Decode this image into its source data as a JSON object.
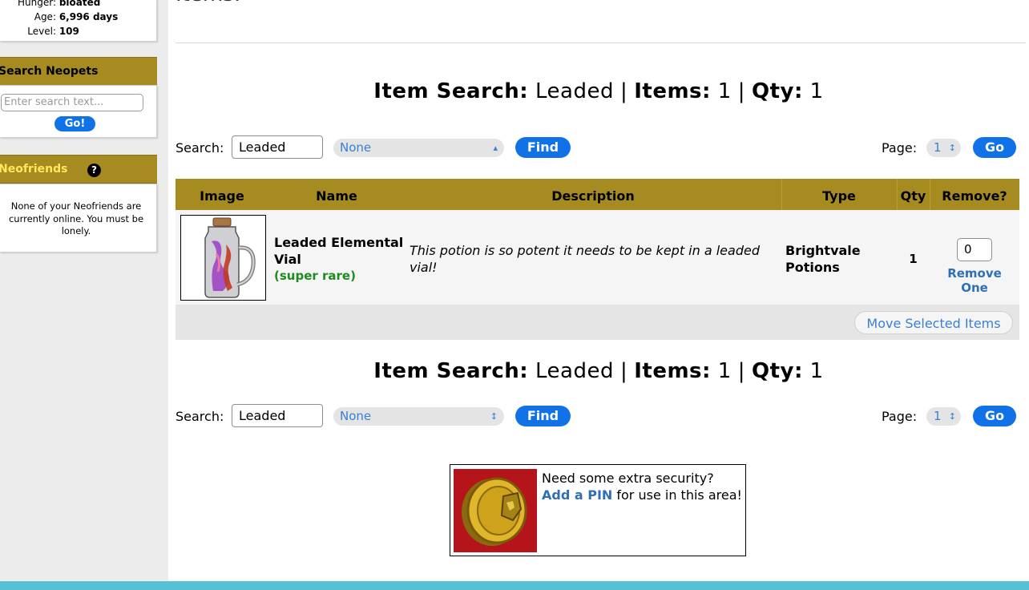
{
  "pet_stats": [
    {
      "label": "Hunger:",
      "value": "bloated"
    },
    {
      "label": "Age:",
      "value": "6,996 days"
    },
    {
      "label": "Level:",
      "value": "109"
    }
  ],
  "search_neopets": {
    "title": "Search Neopets",
    "placeholder": "Enter search text...",
    "go_label": "Go!"
  },
  "neofriends": {
    "title": "Neofriends",
    "help_icon": "?",
    "message": "None of your Neofriends are currently online. You must be lonely."
  },
  "heading": "Items:",
  "summary": {
    "item_search_label": "Item Search:",
    "item_search_value": "Leaded",
    "items_label": "Items:",
    "items_value": "1",
    "qty_label": "Qty:",
    "qty_value": "1",
    "separator": "|"
  },
  "search_bar": {
    "search_label": "Search:",
    "search_value": "Leaded",
    "filter_value": "None",
    "find_label": "Find",
    "page_label": "Page:",
    "page_value": "1",
    "go_label": "Go"
  },
  "table": {
    "headers": [
      "Image",
      "Name",
      "Description",
      "Type",
      "Qty",
      "Remove?"
    ],
    "rows": [
      {
        "name": "Leaded Elemental Vial",
        "rarity": "(super rare)",
        "description": "This potion is so potent it needs to be kept in a leaded vial!",
        "type": "Brightvale Potions",
        "qty": "1",
        "remove_value": "0",
        "remove_one_label": "Remove One"
      }
    ],
    "move_selected_label": "Move Selected Items"
  },
  "pin_promo": {
    "line1": "Need some extra security?",
    "link_text": "Add a PIN",
    "line2_rest": " for use in this area!"
  },
  "colors": {
    "header_gold": "#a68c20",
    "button_blue": "#1172e8",
    "link_blue": "#2f6fb6",
    "rarity_green": "#1f8a1f"
  }
}
